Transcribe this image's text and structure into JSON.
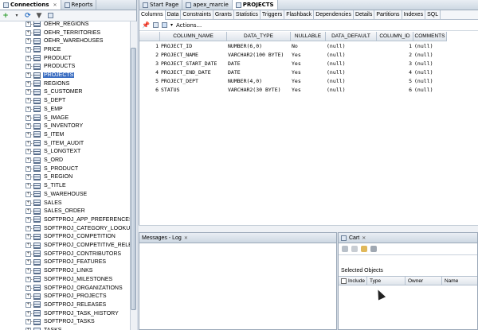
{
  "left_panel": {
    "tabs": [
      {
        "label": "Connections",
        "active": true
      },
      {
        "label": "Reports",
        "active": false
      }
    ],
    "tree": {
      "cut_top_label": "OEHR_REGIONS",
      "items": [
        "OEHR_TERRITORIES",
        "OEHR_WAREHOUSES",
        "PRICE",
        "PRODUCT",
        "PRODUCTS",
        "PROJECTS",
        "REGIONS",
        "S_CUSTOMER",
        "S_DEPT",
        "S_EMP",
        "S_IMAGE",
        "S_INVENTORY",
        "S_ITEM",
        "S_ITEM_AUDIT",
        "S_LONGTEXT",
        "S_ORD",
        "S_PRODUCT",
        "S_REGION",
        "S_TITLE",
        "S_WAREHOUSE",
        "SALES",
        "SALES_ORDER",
        "SOFTPROJ_APP_PREFERENCES",
        "SOFTPROJ_CATEGORY_LOOKUP",
        "SOFTPROJ_COMPETITION",
        "SOFTPROJ_COMPETITIVE_RELEASES",
        "SOFTPROJ_CONTRIBUTORS",
        "SOFTPROJ_FEATURES",
        "SOFTPROJ_LINKS",
        "SOFTPROJ_MILESTONES",
        "SOFTPROJ_ORGANIZATIONS",
        "SOFTPROJ_PROJECTS",
        "SOFTPROJ_RELEASES",
        "SOFTPROJ_TASK_HISTORY",
        "SOFTPROJ_TASKS",
        "TASKS"
      ],
      "cut_bottom_label": "Views",
      "selected": "PROJECTS"
    }
  },
  "editor": {
    "doc_tabs": [
      {
        "label": "Start Page",
        "active": false
      },
      {
        "label": "apex_marcie",
        "active": false
      },
      {
        "label": "PROJECTS",
        "active": true
      }
    ],
    "sub_tabs": [
      "Columns",
      "Data",
      "Constraints",
      "Grants",
      "Statistics",
      "Triggers",
      "Flashback",
      "Dependencies",
      "Details",
      "Partitions",
      "Indexes",
      "SQL"
    ],
    "actions_label": "Actions...",
    "grid": {
      "headers": [
        "COLUMN_NAME",
        "DATA_TYPE",
        "NULLABLE",
        "DATA_DEFAULT",
        "COLUMN_ID",
        "COMMENTS"
      ],
      "rows": [
        {
          "n": "1",
          "name": "PROJECT_ID",
          "type": "NUMBER(6,0)",
          "nullable": "No",
          "default": "(null)",
          "id": "1",
          "comments": "(null)"
        },
        {
          "n": "2",
          "name": "PROJECT_NAME",
          "type": "VARCHAR2(100 BYTE)",
          "nullable": "Yes",
          "default": "(null)",
          "id": "2",
          "comments": "(null)"
        },
        {
          "n": "3",
          "name": "PROJECT_START_DATE",
          "type": "DATE",
          "nullable": "Yes",
          "default": "(null)",
          "id": "3",
          "comments": "(null)"
        },
        {
          "n": "4",
          "name": "PROJECT_END_DATE",
          "type": "DATE",
          "nullable": "Yes",
          "default": "(null)",
          "id": "4",
          "comments": "(null)"
        },
        {
          "n": "5",
          "name": "PROJECT_DEPT",
          "type": "NUMBER(4,0)",
          "nullable": "Yes",
          "default": "(null)",
          "id": "5",
          "comments": "(null)"
        },
        {
          "n": "6",
          "name": "STATUS",
          "type": "VARCHAR2(30 BYTE)",
          "nullable": "Yes",
          "default": "(null)",
          "id": "6",
          "comments": "(null)"
        }
      ]
    }
  },
  "log_panel": {
    "tab_label": "Messages - Log"
  },
  "cart_panel": {
    "tab_label": "Cart",
    "selected_objects_label": "Selected Objects",
    "columns": [
      "Include",
      "Type",
      "Owner",
      "Name"
    ]
  },
  "colors": {
    "selection": "#3d6fc2",
    "panel_bg": "#d6dde6"
  }
}
